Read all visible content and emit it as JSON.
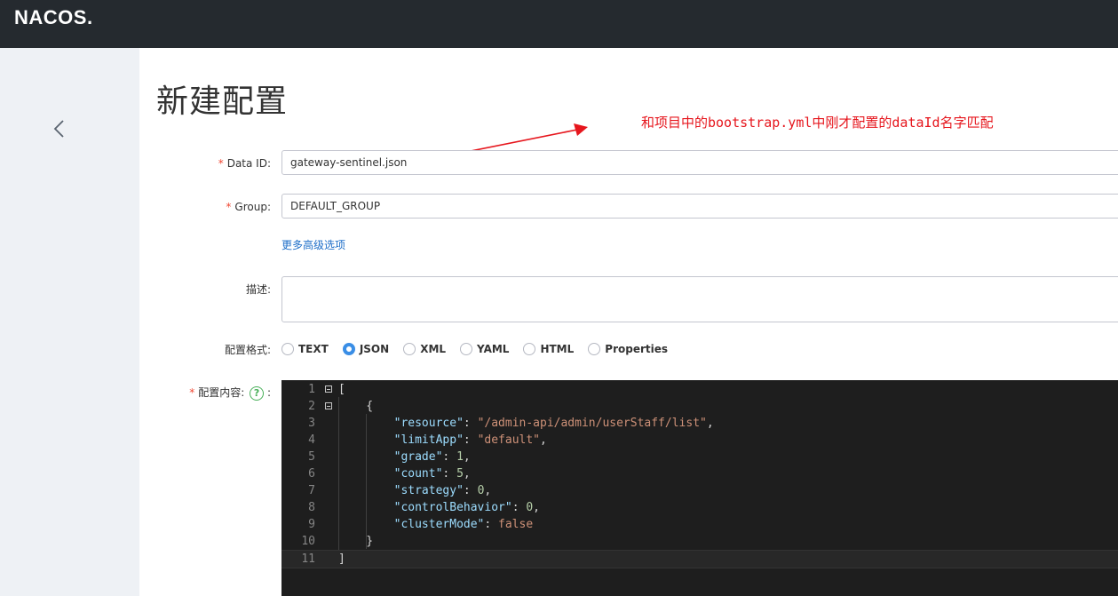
{
  "header": {
    "logo": "NACOS."
  },
  "page": {
    "title": "新建配置"
  },
  "annotation": {
    "text": "和项目中的bootstrap.yml中刚才配置的dataId名字匹配",
    "color": "#e6161d"
  },
  "form": {
    "data_id": {
      "required_mark": "*",
      "label": "Data ID:",
      "value": "gateway-sentinel.json"
    },
    "group": {
      "required_mark": "*",
      "label": "Group:",
      "value": "DEFAULT_GROUP"
    },
    "more_options": "更多高级选项",
    "description": {
      "label": "描述:",
      "value": ""
    },
    "format": {
      "label": "配置格式:",
      "options": [
        "TEXT",
        "JSON",
        "XML",
        "YAML",
        "HTML",
        "Properties"
      ],
      "selected": "JSON"
    },
    "content": {
      "required_mark": "*",
      "label": "配置内容:",
      "help": "?",
      "colon": ":"
    }
  },
  "editor": {
    "line_numbers": [
      "1",
      "2",
      "3",
      "4",
      "5",
      "6",
      "7",
      "8",
      "9",
      "10",
      "11"
    ],
    "lines": [
      [
        {
          "t": "[",
          "c": "p"
        }
      ],
      [
        {
          "t": "    {",
          "c": "p"
        }
      ],
      [
        {
          "t": "        ",
          "c": "p"
        },
        {
          "t": "\"resource\"",
          "c": "k"
        },
        {
          "t": ": ",
          "c": "p"
        },
        {
          "t": "\"/admin-api/admin/userStaff/list\"",
          "c": "s"
        },
        {
          "t": ",",
          "c": "p"
        }
      ],
      [
        {
          "t": "        ",
          "c": "p"
        },
        {
          "t": "\"limitApp\"",
          "c": "k"
        },
        {
          "t": ": ",
          "c": "p"
        },
        {
          "t": "\"default\"",
          "c": "s"
        },
        {
          "t": ",",
          "c": "p"
        }
      ],
      [
        {
          "t": "        ",
          "c": "p"
        },
        {
          "t": "\"grade\"",
          "c": "k"
        },
        {
          "t": ": ",
          "c": "p"
        },
        {
          "t": "1",
          "c": "n"
        },
        {
          "t": ",",
          "c": "p"
        }
      ],
      [
        {
          "t": "        ",
          "c": "p"
        },
        {
          "t": "\"count\"",
          "c": "k"
        },
        {
          "t": ": ",
          "c": "p"
        },
        {
          "t": "5",
          "c": "n"
        },
        {
          "t": ",",
          "c": "p"
        }
      ],
      [
        {
          "t": "        ",
          "c": "p"
        },
        {
          "t": "\"strategy\"",
          "c": "k"
        },
        {
          "t": ": ",
          "c": "p"
        },
        {
          "t": "0",
          "c": "n"
        },
        {
          "t": ",",
          "c": "p"
        }
      ],
      [
        {
          "t": "        ",
          "c": "p"
        },
        {
          "t": "\"controlBehavior\"",
          "c": "k"
        },
        {
          "t": ": ",
          "c": "p"
        },
        {
          "t": "0",
          "c": "n"
        },
        {
          "t": ",",
          "c": "p"
        }
      ],
      [
        {
          "t": "        ",
          "c": "p"
        },
        {
          "t": "\"clusterMode\"",
          "c": "k"
        },
        {
          "t": ": ",
          "c": "p"
        },
        {
          "t": "false",
          "c": "s"
        }
      ],
      [
        {
          "t": "    }",
          "c": "p"
        }
      ],
      [
        {
          "t": "]",
          "c": "p"
        }
      ]
    ],
    "foldable_lines": [
      "1",
      "2"
    ],
    "current_line": "11"
  }
}
